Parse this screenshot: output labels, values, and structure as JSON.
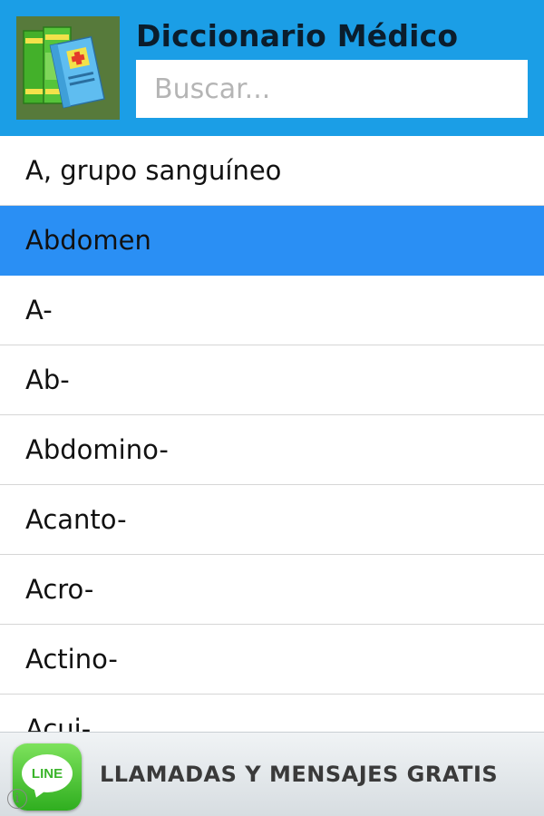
{
  "header": {
    "title": "Diccionario Médico",
    "icon": "medical-books-icon",
    "background": "#1b9ee6"
  },
  "search": {
    "placeholder": "Buscar...",
    "value": ""
  },
  "list": {
    "selected_background": "#2a8ff4",
    "items": [
      {
        "label": "A, grupo sanguíneo",
        "selected": false
      },
      {
        "label": "Abdomen",
        "selected": true
      },
      {
        "label": "A-",
        "selected": false
      },
      {
        "label": "Ab-",
        "selected": false
      },
      {
        "label": "Abdomino-",
        "selected": false
      },
      {
        "label": "Acanto-",
        "selected": false
      },
      {
        "label": "Acro-",
        "selected": false
      },
      {
        "label": "Actino-",
        "selected": false
      },
      {
        "label": "Acui-",
        "selected": false
      }
    ]
  },
  "ad": {
    "logo_text": "LINE",
    "text": "LLAMADAS Y MENSAJES GRATIS",
    "info_icon": "info-icon"
  }
}
